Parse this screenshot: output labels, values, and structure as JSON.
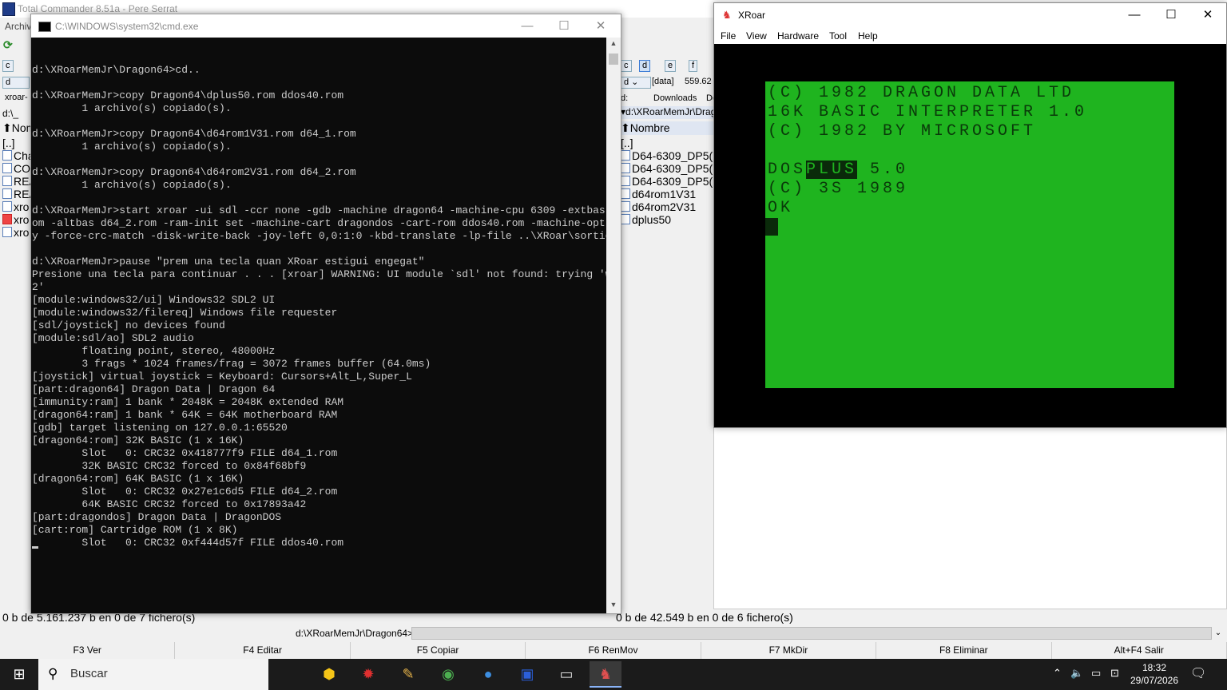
{
  "total_commander": {
    "title": "Total Commander 8.51a - Pere Serrat",
    "menu_fragment": "Archiv",
    "left_panel": {
      "drive_buttons": [
        "c"
      ],
      "drive_combo": "d",
      "tab": "xroar-",
      "path_fragment": "d:\\_",
      "header": "Nom",
      "files": [
        "[..]",
        "Cha",
        "CO",
        "REA",
        "REA",
        "xro",
        "xro",
        "xro"
      ]
    },
    "right_panel": {
      "drive_buttons": [
        "c",
        "d",
        "e",
        "f"
      ],
      "drive_combo": "d",
      "drive_label": "[data]",
      "free_space": "559.62",
      "tabs": [
        "d:",
        "Downloads",
        "De"
      ],
      "path": "d:\\XRoarMemJr\\Drago",
      "header": "Nombre",
      "files": [
        "[..]",
        "D64-6309_DP5(",
        "D64-6309_DP5(",
        "D64-6309_DP5(",
        "d64rom1V31",
        "d64rom2V31",
        "dplus50"
      ]
    },
    "status_left": "0 b de 5.161.237 b en 0 de 7 fichero(s)",
    "status_right": "0 b de 42.549 b en 0 de 6 fichero(s)",
    "command_path": "d:\\XRoarMemJr\\Dragon64>",
    "fkeys": [
      "F3 Ver",
      "F4 Editar",
      "F5 Copiar",
      "F6 RenMov",
      "F7 MkDir",
      "F8 Eliminar",
      "Alt+F4 Salir"
    ]
  },
  "cmd": {
    "title": "C:\\WINDOWS\\system32\\cmd.exe",
    "output": "d:\\XRoarMemJr\\Dragon64>cd..\n\nd:\\XRoarMemJr>copy Dragon64\\dplus50.rom ddos40.rom\n        1 archivo(s) copiado(s).\n\nd:\\XRoarMemJr>copy Dragon64\\d64rom1V31.rom d64_1.rom\n        1 archivo(s) copiado(s).\n\nd:\\XRoarMemJr>copy Dragon64\\d64rom2V31.rom d64_2.rom\n        1 archivo(s) copiado(s).\n\nd:\\XRoarMemJr>start xroar -ui sdl -ccr none -gdb -machine dragon64 -machine-cpu 6309 -extbas d64_1.r\nom -altbas d64_2.rom -ram-init set -machine-cart dragondos -cart-rom ddos40.rom -machine-opt immunit\ny -force-crc-match -disk-write-back -joy-left 0,0:1:0 -kbd-translate -lp-file ..\\XRoar\\sortida.txt\n\nd:\\XRoarMemJr>pause \"prem una tecla quan XRoar estigui engegat\"\nPresione una tecla para continuar . . . [xroar] WARNING: UI module `sdl' not found: trying 'windows3\n2'\n[module:windows32/ui] Windows32 SDL2 UI\n[module:windows32/filereq] Windows file requester\n[sdl/joystick] no devices found\n[module:sdl/ao] SDL2 audio\n        floating point, stereo, 48000Hz\n        3 frags * 1024 frames/frag = 3072 frames buffer (64.0ms)\n[joystick] virtual joystick = Keyboard: Cursors+Alt_L,Super_L\n[part:dragon64] Dragon Data | Dragon 64\n[immunity:ram] 1 bank * 2048K = 2048K extended RAM\n[dragon64:ram] 1 bank * 64K = 64K motherboard RAM\n[gdb] target listening on 127.0.0.1:65520\n[dragon64:rom] 32K BASIC (1 x 16K)\n        Slot   0: CRC32 0x418777f9 FILE d64_1.rom\n        32K BASIC CRC32 forced to 0x84f68bf9\n[dragon64:rom] 64K BASIC (1 x 16K)\n        Slot   0: CRC32 0x27e1c6d5 FILE d64_2.rom\n        64K BASIC CRC32 forced to 0x17893a42\n[part:dragondos] Dragon Data | DragonDOS\n[cart:rom] Cartridge ROM (1 x 8K)\n        Slot   0: CRC32 0xf444d57f FILE ddos40.rom"
  },
  "xroar": {
    "title": "XRoar",
    "menu": [
      "File",
      "View",
      "Hardware",
      "Tool",
      "Help"
    ],
    "screen": {
      "line1": "(C) 1982 DRAGON DATA LTD",
      "line2": "16K BASIC INTERPRETER 1.0",
      "line3": "(C) 1982 BY MICROSOFT",
      "line5a": "DOS",
      "line5b": "PLUS",
      "line5c": " 5.0",
      "line6": "(C) 3S 1989",
      "line7": "OK"
    },
    "colors": {
      "screen_green": "#1fb41f",
      "border": "#000000"
    }
  },
  "taskbar": {
    "search_placeholder": "Buscar",
    "apps": [
      "app-icon",
      "32-icon",
      "notes-icon",
      "chrome-icon",
      "thunderbird-icon",
      "save-icon",
      "terminal-icon",
      "xroar-icon"
    ],
    "time": "18:32",
    "date": "29/07/2026"
  }
}
